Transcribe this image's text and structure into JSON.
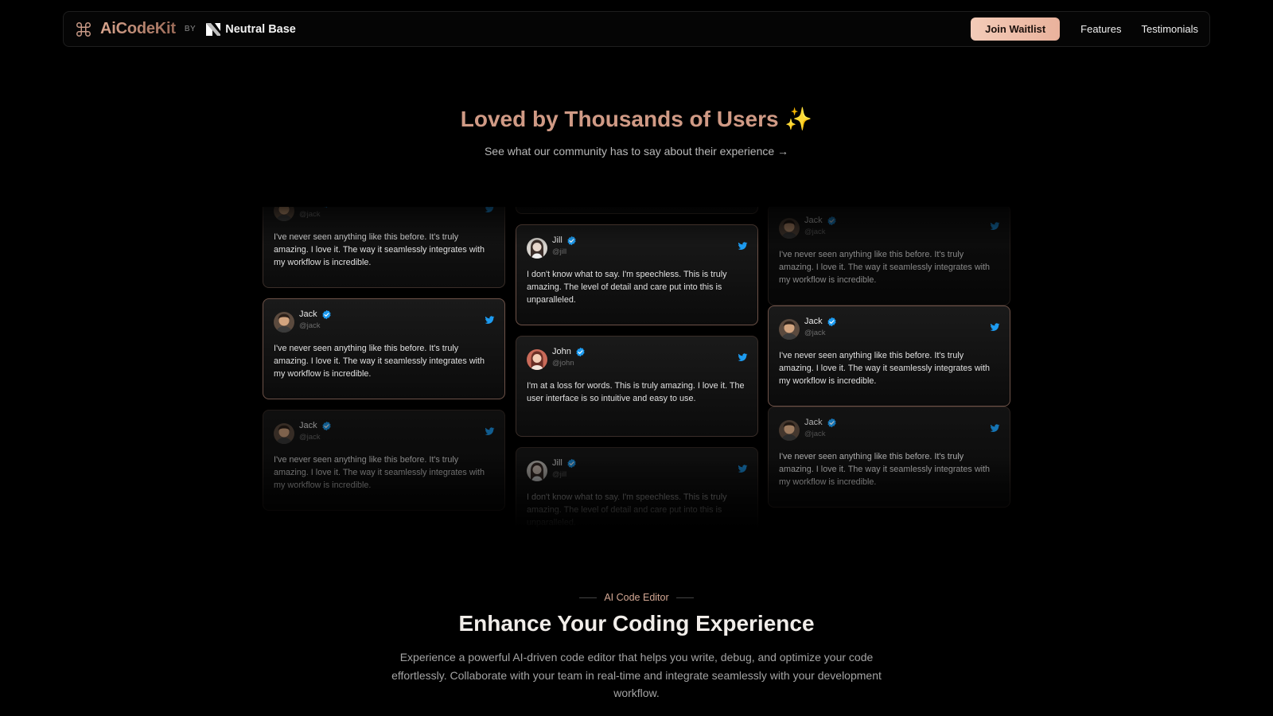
{
  "nav": {
    "brand_name": "AiCodeKit",
    "by_label": "BY",
    "partner_name": "Neutral Base",
    "cta_label": "Join Waitlist",
    "links": [
      "Features",
      "Testimonials"
    ]
  },
  "hero": {
    "title": "Loved by Thousands of Users",
    "title_emoji": "✨",
    "subtitle": "See what our community has to say about their experience →"
  },
  "testimonials": {
    "jack": {
      "name": "Jack",
      "handle": "@jack",
      "text": "I've never seen anything like this before. It's truly amazing. I love it. The way it seamlessly integrates with my workflow is incredible."
    },
    "jill": {
      "name": "Jill",
      "handle": "@jill",
      "text": "I don't know what to say. I'm speechless. This is truly amazing. The level of detail and care put into this is unparalleled."
    },
    "john": {
      "name": "John",
      "handle": "@john",
      "text": "I'm at a loss for words. This is truly amazing. I love it. The user interface is so intuitive and easy to use."
    }
  },
  "feature": {
    "eyebrow": "AI Code Editor",
    "title": "Enhance Your Coding Experience",
    "description": "Experience a powerful AI-driven code editor that helps you write, debug, and optimize your code effortlessly. Collaborate with your team in real-time and integrate seamlessly with your development workflow."
  },
  "colors": {
    "accent": "#d09a85",
    "cta": "#f3cbb8",
    "verified": "#1d9bf0",
    "background": "#000000"
  },
  "icons": [
    "brand-logo-icon",
    "neutral-base-logo-icon",
    "verified-icon",
    "twitter-icon"
  ]
}
